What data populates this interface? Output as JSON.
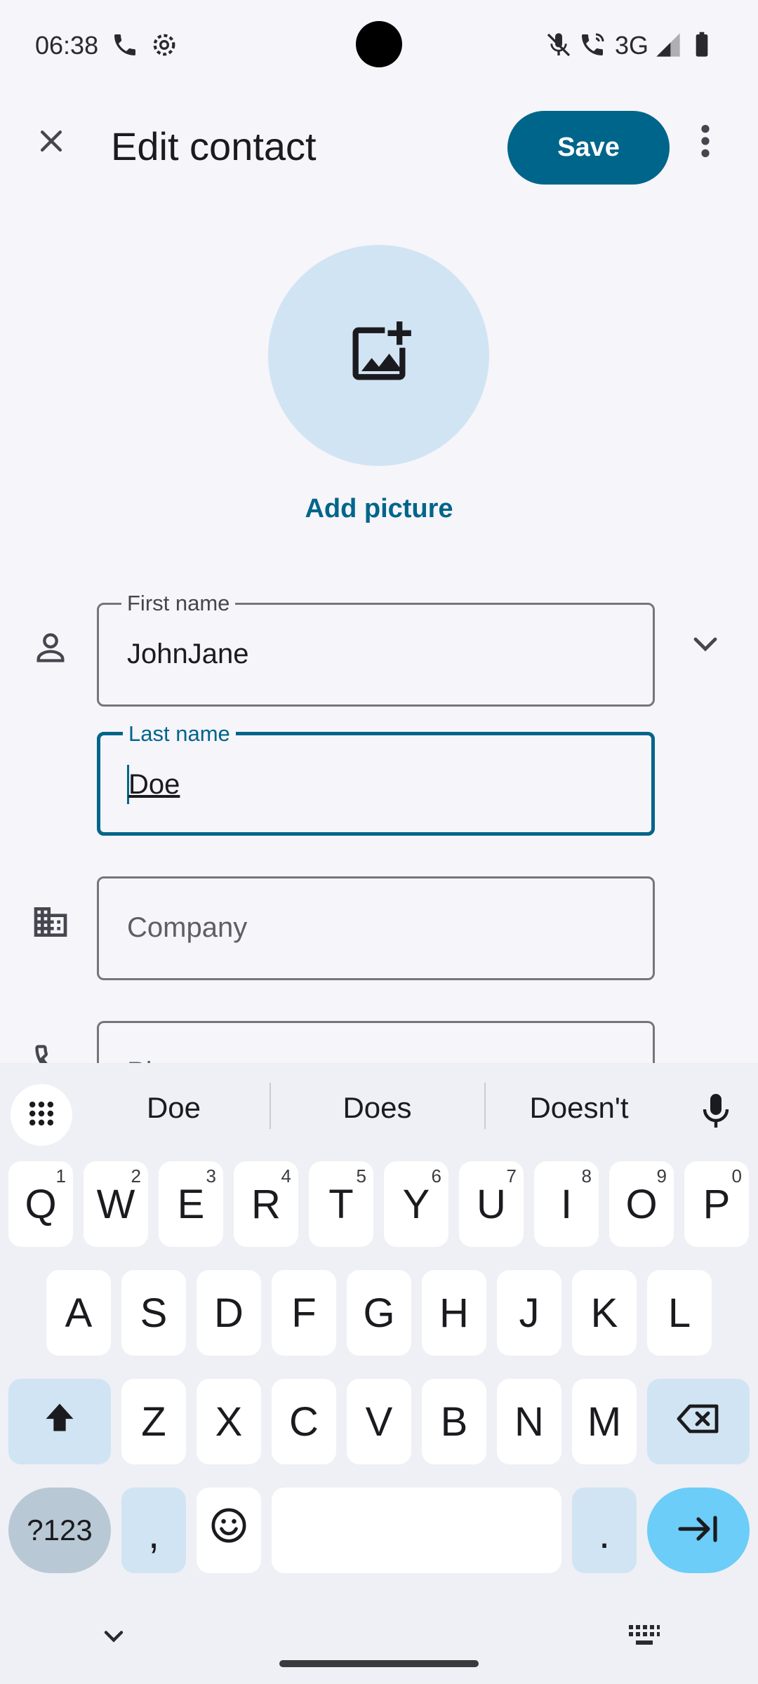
{
  "status_bar": {
    "time": "06:38",
    "network": "3G",
    "icons": [
      "phone-icon",
      "settings-gear-icon",
      "mute-mic-icon",
      "wifi-calling-icon",
      "signal-icon",
      "battery-icon"
    ]
  },
  "app_bar": {
    "title": "Edit contact",
    "save_label": "Save",
    "icons": [
      "close-icon",
      "more-vert-icon"
    ]
  },
  "avatar": {
    "icon": "add-photo-icon",
    "add_picture_label": "Add picture"
  },
  "fields": {
    "first_name": {
      "label": "First name",
      "value": "JohnJane"
    },
    "last_name": {
      "label": "Last name",
      "value": "Doe"
    },
    "company": {
      "placeholder": "Company"
    },
    "phone": {
      "placeholder": "Phone"
    }
  },
  "keyboard": {
    "suggestions": [
      "Doe",
      "Does",
      "Doesn't"
    ],
    "row1": [
      {
        "k": "Q",
        "h": "1"
      },
      {
        "k": "W",
        "h": "2"
      },
      {
        "k": "E",
        "h": "3"
      },
      {
        "k": "R",
        "h": "4"
      },
      {
        "k": "T",
        "h": "5"
      },
      {
        "k": "Y",
        "h": "6"
      },
      {
        "k": "U",
        "h": "7"
      },
      {
        "k": "I",
        "h": "8"
      },
      {
        "k": "O",
        "h": "9"
      },
      {
        "k": "P",
        "h": "0"
      }
    ],
    "row2": [
      "A",
      "S",
      "D",
      "F",
      "G",
      "H",
      "J",
      "K",
      "L"
    ],
    "row3": [
      "Z",
      "X",
      "C",
      "V",
      "B",
      "N",
      "M"
    ],
    "symbols_label": "?123",
    "comma": ",",
    "period": "."
  },
  "colors": {
    "accent": "#00658a",
    "avatar_bg": "#d1e4f3",
    "enter_key": "#6ccdf8"
  }
}
